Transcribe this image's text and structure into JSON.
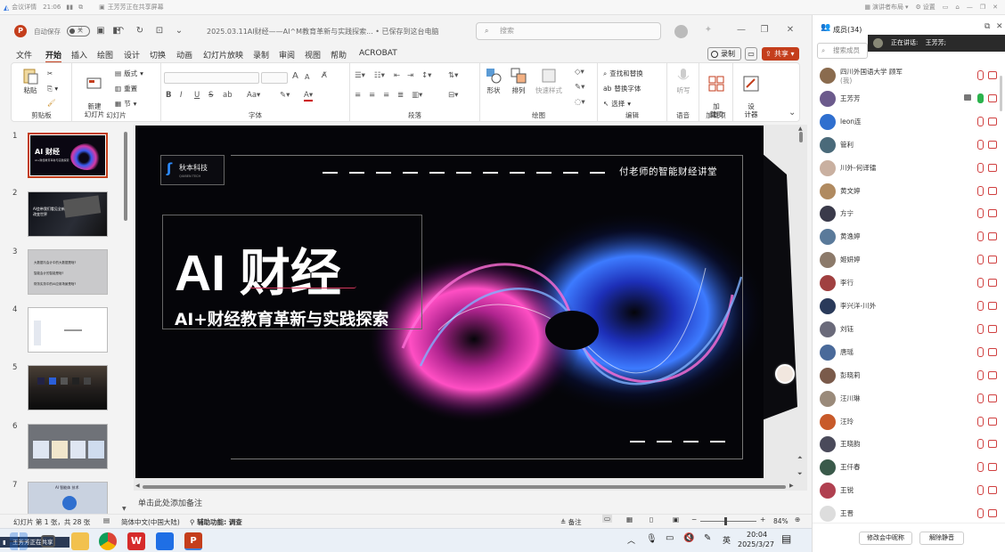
{
  "meeting_bar": {
    "meeting_details": "会议详情",
    "elapsed": "21:06",
    "sharing_text": "王芳芳正在共享屏幕",
    "gallery_label": "演讲者布局",
    "settings_label": "设置"
  },
  "titlebar": {
    "autosave_label": "自动保存",
    "autosave_state": "关",
    "doc_title": "2025.03.11AI财经——AI^M教育革新与实践探索...  •  已保存到这台电脑",
    "search_placeholder": "搜索"
  },
  "menu": {
    "tabs": [
      "文件",
      "开始",
      "插入",
      "绘图",
      "设计",
      "切换",
      "动画",
      "幻灯片放映",
      "录制",
      "审阅",
      "视图",
      "帮助",
      "ACROBAT"
    ],
    "active": "开始",
    "record_label": "录制",
    "share_label": "共享"
  },
  "ribbon": {
    "clipboard": {
      "paste": "粘贴",
      "label": "剪贴板"
    },
    "slides": {
      "new_slide": "新建\n幻灯片",
      "layout": "版式",
      "reset": "重置",
      "section": "节",
      "label": "幻灯片"
    },
    "font": {
      "label": "字体",
      "bold": "B",
      "italic": "I",
      "underline": "U",
      "strike": "S",
      "spacing": "ab",
      "grow": "A",
      "shrink": "A"
    },
    "paragraph": {
      "label": "段落"
    },
    "drawing": {
      "shapes": "形状",
      "arrange": "排列",
      "quick_styles": "快速样式",
      "label": "绘图"
    },
    "editing": {
      "find_replace": "查找和替换",
      "replace_font": "替换字体",
      "select": "选择",
      "label": "编辑"
    },
    "voice": {
      "dictate": "听写",
      "label": "语音"
    },
    "addins": {
      "addins": "加\n载项",
      "label": "加载项"
    },
    "designer": {
      "designer": "设\n计器"
    }
  },
  "thumbnails": [
    {
      "num": "1",
      "title": "AI 财经",
      "sub": "AI+财经教育革新与实践探索"
    },
    {
      "num": "2",
      "title": "AI会带我们看见全新的方\n改变世界"
    },
    {
      "num": "3",
      "line1": "大数据与会计中的大数据是啥?",
      "line2": "智能会计的智能是啥?",
      "line3": "财务实务中的AI应用场景是啥?"
    },
    {
      "num": "4"
    },
    {
      "num": "5"
    },
    {
      "num": "6"
    },
    {
      "num": "7",
      "title": "AI 智能体 技术"
    }
  ],
  "slide": {
    "logo_main": "秋本科技",
    "logo_sub": "QIUBEN TECH",
    "tagline": "付老师的智能财经讲堂",
    "title": "AI 财经",
    "subtitle": "AI+财经教育革新与实践探索"
  },
  "notes_placeholder": "单击此处添加备注",
  "status": {
    "slide_of": "幻灯片 第 1 张，共 28 张",
    "language": "简体中文(中国大陆)",
    "accessibility": "辅助功能: 调查",
    "notes": "备注",
    "zoom": "84%"
  },
  "taskbar": {
    "sharing": "王芳芳正在共享",
    "ime": "英",
    "time": "20:04",
    "date": "2025/3/27"
  },
  "panel": {
    "header": "成员(34)",
    "speaking_label": "正在讲话:",
    "speaking_name": "王芳芳;",
    "search_placeholder": "搜索成员",
    "participants": [
      {
        "name": "四川外国语大学 顾军",
        "sub": "(我)"
      },
      {
        "name": "王芳芳"
      },
      {
        "name": "leon连"
      },
      {
        "name": "管利"
      },
      {
        "name": "川外-何译镭"
      },
      {
        "name": "黄文婷"
      },
      {
        "name": "方宁"
      },
      {
        "name": "黄逸婷"
      },
      {
        "name": "姬妍婷"
      },
      {
        "name": "李行"
      },
      {
        "name": "李兴洋-川外"
      },
      {
        "name": "刘钰"
      },
      {
        "name": "唐瑶"
      },
      {
        "name": "彭晓莉"
      },
      {
        "name": "汪川琳"
      },
      {
        "name": "汪玲"
      },
      {
        "name": "王晓韵"
      },
      {
        "name": "王仟春"
      },
      {
        "name": "王锐"
      },
      {
        "name": "王晋"
      }
    ],
    "rename_button": "修改会中昵称",
    "unmute_button": "解除静音"
  },
  "colors": {
    "accent": "#c43e1c",
    "slide_bg": "#050509",
    "panel_bg": "#ffffff"
  }
}
